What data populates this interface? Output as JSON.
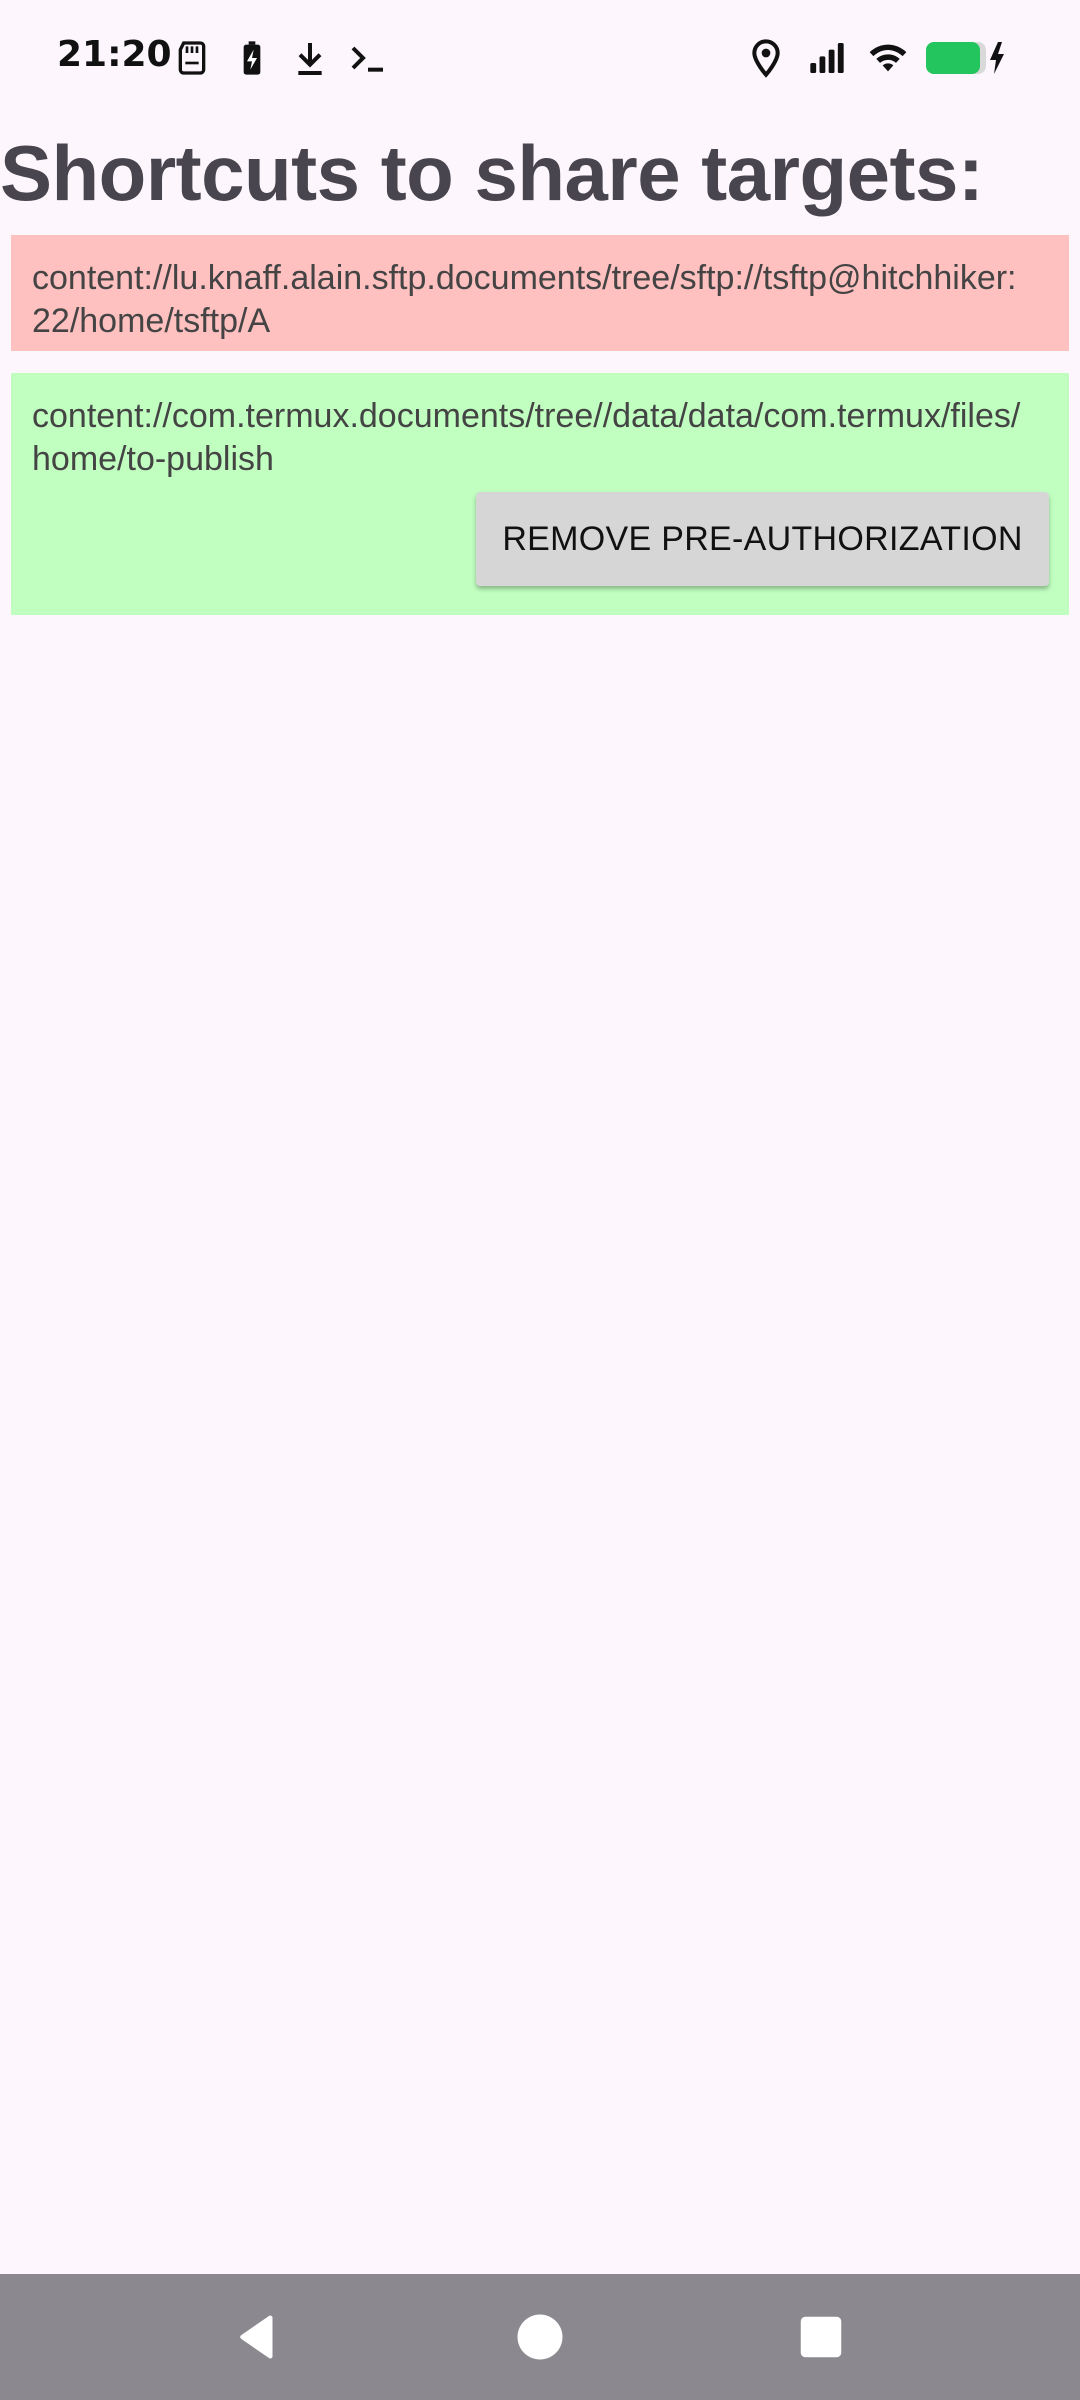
{
  "status_bar": {
    "time": "21:20",
    "icons": [
      "sd-card-icon",
      "battery-saver-icon",
      "download-icon",
      "terminal-icon",
      "location-icon",
      "signal-icon",
      "wifi-icon",
      "battery-charging-icon"
    ],
    "battery_color": "#22c55e"
  },
  "page": {
    "title": "Shortcuts to share targets:"
  },
  "targets": [
    {
      "uri": "content://lu.knaff.alain.sftp.documents/tree/sftp://tsftp@hitchhiker:22/home/tsftp/A",
      "background": "#ffc0c0"
    },
    {
      "uri": "content://com.termux.documents/tree//data/data/com.termux/files/home/to-publish",
      "background": "#c0ffc0",
      "button_label": "REMOVE PRE-AUTHORIZATION"
    }
  ],
  "nav_bar": {
    "buttons": [
      "back-icon",
      "home-icon",
      "recents-icon"
    ]
  }
}
